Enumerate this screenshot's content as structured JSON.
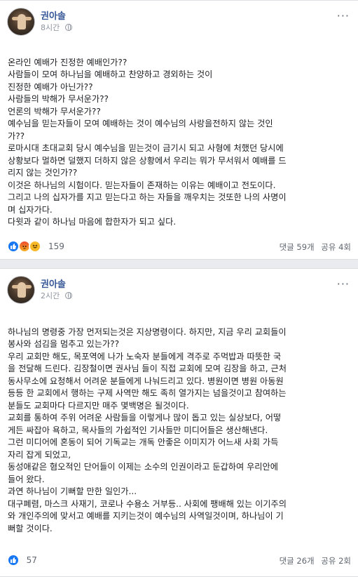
{
  "posts": [
    {
      "author": "권아솔",
      "time": "8시간",
      "more": "···",
      "lines": [
        "온라인 예배가 진정한 예배인가??",
        "사람들이 모여 하나님을 예배하고 찬양하고 경외하는 것이",
        "진정한 예배가 아닌가??",
        "사람들의 박해가 무서운가??",
        "언론의 박해가 무서운가??",
        "예수님을 믿는자들이 모여 예배하는 것이 예수님의 사랑을전하지 않는 것인",
        "가??",
        "로마시대 초대교회 당시 예수님을 믿는것이 금기시 되고 사형에 처했던 당시에",
        "상황보다 멀하면 덜했지 더하지 않은 상황에서 우리는 뭐가 무서워서 예배를 드",
        "리지 않는 것인가??",
        "이것은 하나님의 시험이다. 믿는자들이 존재하는 이유는 예배이고 전도이다.",
        "그리고 나의 십자가를 지고 믿는다고 하는 자들을 깨우치는 것또한 나의 사명이",
        "며 십자가다.",
        "다윗과 같이 하나님 마음에 합한자가 되고 싶다."
      ],
      "reaction_count": "159",
      "comments": "댓글 59개",
      "shares": "공유 4회"
    },
    {
      "author": "권아솔",
      "time": "2시간",
      "more": "···",
      "lines": [
        "하나님의 명령중 가장 먼저되는것은 지상명령이다. 하지만, 지금 우리 교회들이",
        "봉사와 섬김을 멈추고 있는가??",
        "우리 교회만 해도, 목포역에 나가 노숙자 분들에게 격주로 주먹밥과 따뜻한 국",
        "을 전달해 드린다. 김장철이면 권사님 들이 직접 교회에 모여 김장을 하고, 근처",
        "동사무소에 요청해서 어려운 분들에게 나눠드리고 있다. 병원이면 병원 아동원",
        "등등 한 교회에서 행하는 구제 사역만 해도 족히 열가지는 넘을것이고 참여하는",
        "분들도 교회마다 다르지만 매주 몇백명은 될것이다.",
        "교회를 통하여 주위 어려운 사람들을 이렇게나 많이 돕고 있는 실상보다, 어떻",
        "게든 싸잡아 욕하고, 목사들의 가쉽적인 기사들만 미디어들은 생산해낸다.",
        "그런 미디어에 혼동이 되어 기독교는 개독 안좋은 이미지가 어느새 사회 가득",
        "자리 잡게 되었고,",
        "동성애같은 혐오적인 단어들이 이제는 소수의 인권이라고 둔갑하여 우리안에",
        "들어 왔다.",
        "과연 하나님이 기뻐할 만한 일인가...",
        "대구폐렴, 마스크 사재기, 코로나 수용소 거부등.. 사회에 팽배해 있는 이기주의",
        "와 개인주의에 맞서고 예배를 지키는것이 예수님의 사역일것이며, 하나님이 기",
        "뻐할 것이다."
      ],
      "reaction_count": "57",
      "comments": "댓글 26개",
      "shares": "공유 2회"
    }
  ],
  "icons": {
    "like": "like-icon",
    "angry": "angry-icon",
    "haha": "haha-icon",
    "globe": "globe-icon"
  },
  "colors": {
    "author": "#385898",
    "like": "#1877f2",
    "background": "#e9ebee"
  }
}
